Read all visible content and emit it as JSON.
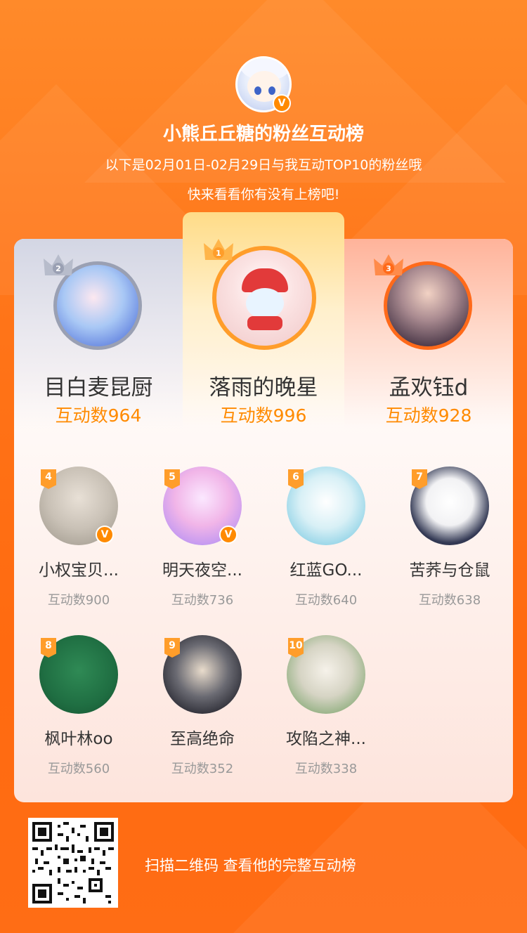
{
  "colors": {
    "accent": "#ff8a00",
    "bg": "#ff7418",
    "text": "#333333",
    "muted": "#999999"
  },
  "header": {
    "title": "小熊丘丘糖的粉丝互动榜",
    "subtitle_line1": "以下是02月01日-02月29日与我互动TOP10的粉丝哦",
    "subtitle_line2": "快来看看你有没有上榜吧!"
  },
  "podium": [
    {
      "rank": "2",
      "name": "目白麦昆厨",
      "score": "互动数964"
    },
    {
      "rank": "1",
      "name": "落雨的晚星",
      "score": "互动数996"
    },
    {
      "rank": "3",
      "name": "孟欢钰d",
      "score": "互动数928"
    }
  ],
  "fans": [
    {
      "rank": "4",
      "name": "小权宝贝...",
      "score": "互动数900",
      "verified": true
    },
    {
      "rank": "5",
      "name": "明天夜空...",
      "score": "互动数736",
      "verified": true
    },
    {
      "rank": "6",
      "name": "红蓝GO...",
      "score": "互动数640",
      "verified": false
    },
    {
      "rank": "7",
      "name": "苦荞与仓鼠",
      "score": "互动数638",
      "verified": false
    },
    {
      "rank": "8",
      "name": "枫叶林oo",
      "score": "互动数560",
      "verified": false
    },
    {
      "rank": "9",
      "name": "至高绝命",
      "score": "互动数352",
      "verified": false
    },
    {
      "rank": "10",
      "name": "攻陷之神...",
      "score": "互动数338",
      "verified": false
    }
  ],
  "badge_glyph": "V",
  "footer": {
    "cta": "扫描二维码 查看他的完整互动榜"
  }
}
